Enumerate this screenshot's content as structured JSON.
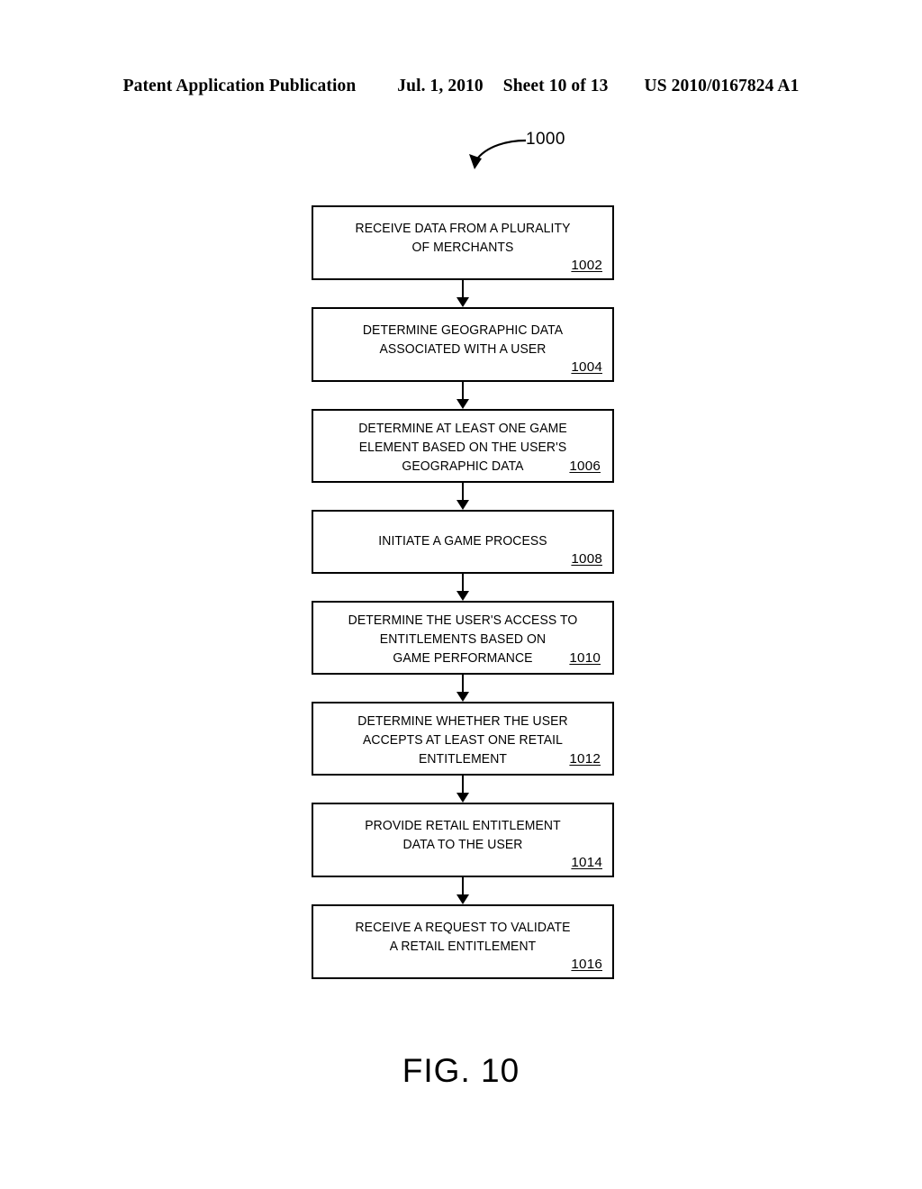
{
  "header": {
    "title": "Patent Application Publication",
    "date": "Jul. 1, 2010",
    "sheet": "Sheet 10 of 13",
    "publication_number": "US 2010/0167824 A1"
  },
  "figure": {
    "caption": "FIG. 10",
    "lead_label": "1000",
    "lead_arrow_icon": "curved-arrow-icon"
  },
  "flowchart": {
    "type": "flowchart",
    "orientation": "vertical",
    "connector_icon": "down-arrow-icon",
    "steps": [
      {
        "text": "RECEIVE DATA FROM A PLURALITY\nOF MERCHANTS",
        "ref": "1002",
        "lines": 2
      },
      {
        "text": "DETERMINE GEOGRAPHIC DATA\nASSOCIATED WITH A USER",
        "ref": "1004",
        "lines": 2
      },
      {
        "text": "DETERMINE AT LEAST ONE GAME\nELEMENT BASED ON THE USER'S\nGEOGRAPHIC DATA",
        "ref": "1006",
        "lines": 3
      },
      {
        "text": "INITIATE A GAME PROCESS",
        "ref": "1008",
        "lines": 1
      },
      {
        "text": "DETERMINE THE USER'S ACCESS TO\nENTITLEMENTS BASED ON\nGAME PERFORMANCE",
        "ref": "1010",
        "lines": 3
      },
      {
        "text": "DETERMINE WHETHER THE USER\nACCEPTS AT LEAST ONE RETAIL\nENTITLEMENT",
        "ref": "1012",
        "lines": 3
      },
      {
        "text": "PROVIDE RETAIL ENTITLEMENT\nDATA TO THE USER",
        "ref": "1014",
        "lines": 2
      },
      {
        "text": "RECEIVE A REQUEST TO VALIDATE\nA RETAIL ENTITLEMENT",
        "ref": "1016",
        "lines": 2
      }
    ]
  },
  "colors": {
    "ink": "#000000",
    "paper": "#ffffff"
  }
}
